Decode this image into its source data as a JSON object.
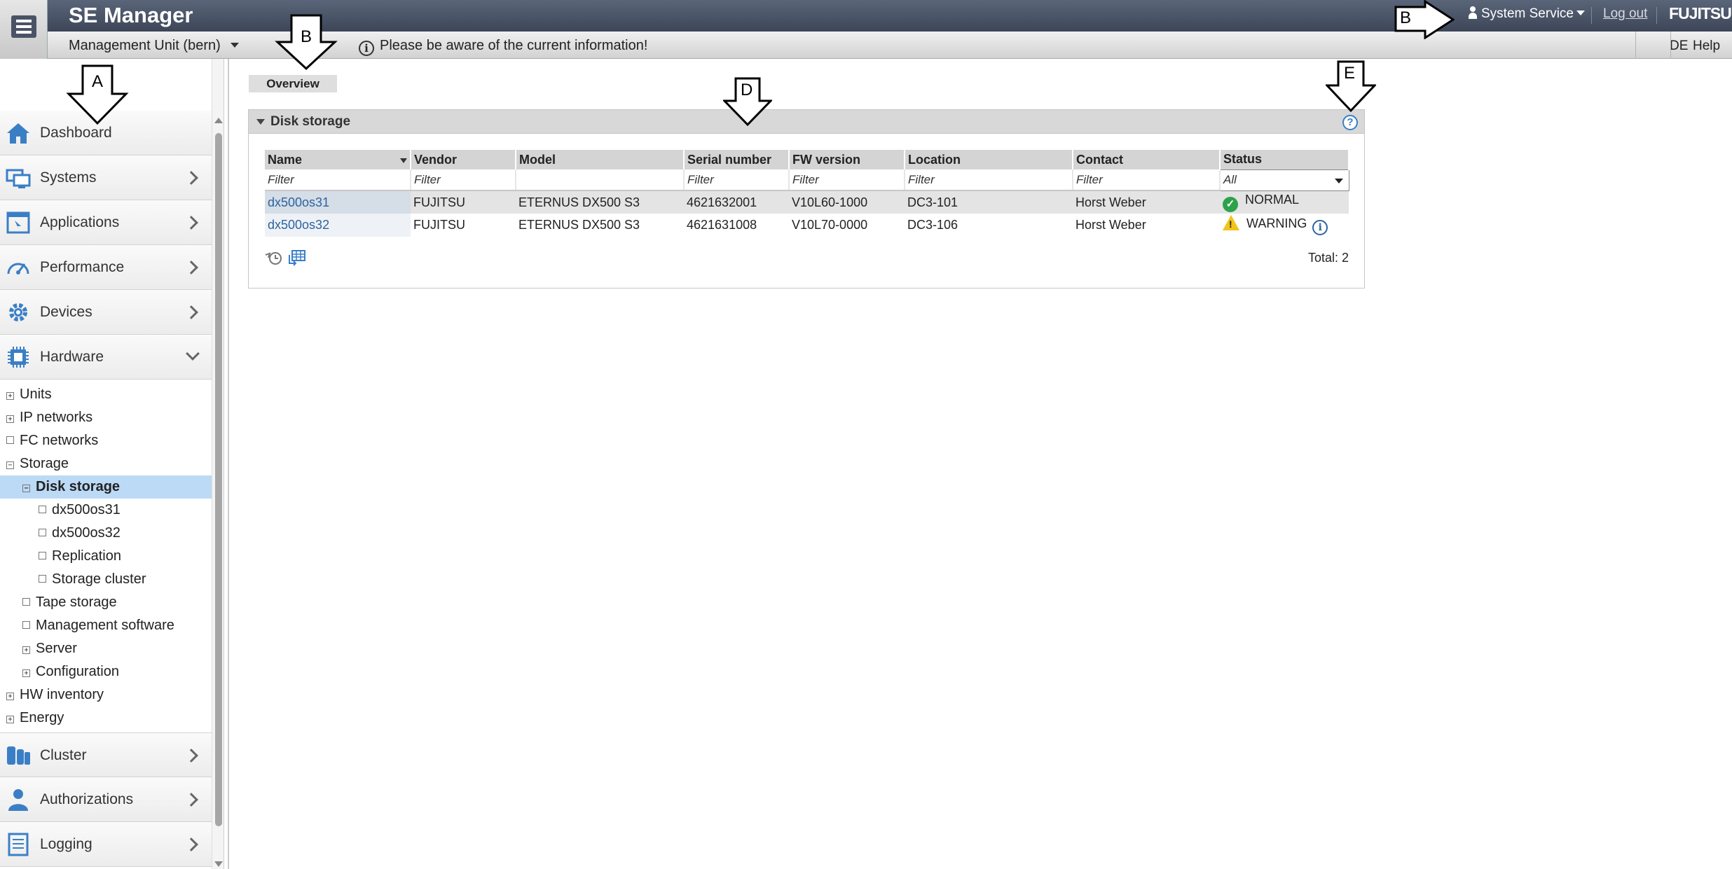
{
  "app": {
    "title": "SE Manager",
    "brand": "FUJITSU",
    "user_menu": "System Service",
    "logout": "Log out",
    "unit_select": "Management Unit (bern)",
    "info_message": "Please be aware of the current information!",
    "lang": "DE",
    "help": "Help"
  },
  "sidebar": {
    "menu": [
      {
        "label": "Dashboard",
        "icon": "home-icon"
      },
      {
        "label": "Systems",
        "icon": "systems-icon"
      },
      {
        "label": "Applications",
        "icon": "applications-icon"
      },
      {
        "label": "Performance",
        "icon": "gauge-icon"
      },
      {
        "label": "Devices",
        "icon": "gear-icon"
      },
      {
        "label": "Hardware",
        "icon": "chip-icon"
      }
    ],
    "tree": [
      {
        "label": "Units",
        "box": "+"
      },
      {
        "label": "IP networks",
        "box": "+"
      },
      {
        "label": "FC networks",
        "box": ""
      },
      {
        "label": "Storage",
        "box": "−"
      },
      {
        "label": "Disk storage",
        "box": "−"
      },
      {
        "label": "dx500os31",
        "box": ""
      },
      {
        "label": "dx500os32",
        "box": ""
      },
      {
        "label": "Replication",
        "box": ""
      },
      {
        "label": "Storage cluster",
        "box": ""
      },
      {
        "label": "Tape storage",
        "box": ""
      },
      {
        "label": "Management software",
        "box": ""
      },
      {
        "label": "Server",
        "box": "+"
      },
      {
        "label": "Configuration",
        "box": "+"
      },
      {
        "label": "HW inventory",
        "box": "+"
      },
      {
        "label": "Energy",
        "box": "+"
      }
    ],
    "menu_bottom": [
      {
        "label": "Cluster",
        "icon": "cluster-icon"
      },
      {
        "label": "Authorizations",
        "icon": "user-icon"
      },
      {
        "label": "Logging",
        "icon": "log-icon"
      }
    ]
  },
  "content": {
    "tab": "Overview",
    "panel_title": "Disk storage",
    "columns": [
      "Name",
      "Vendor",
      "Model",
      "Serial number",
      "FW version",
      "Location",
      "Contact",
      "Status"
    ],
    "filter_placeholder": "Filter",
    "status_filter": "All",
    "rows": [
      {
        "name": "dx500os31",
        "vendor": "FUJITSU",
        "model": "ETERNUS DX500 S3",
        "serial": "4621632001",
        "fw": "V10L60-1000",
        "location": "DC3-101",
        "contact": "Horst Weber",
        "status": "NORMAL"
      },
      {
        "name": "dx500os32",
        "vendor": "FUJITSU",
        "model": "ETERNUS DX500 S3",
        "serial": "4621631008",
        "fw": "V10L70-0000",
        "location": "DC3-106",
        "contact": "Horst Weber",
        "status": "WARNING"
      }
    ],
    "total": "Total: 2"
  },
  "annotations": {
    "a": "A",
    "b1": "B",
    "b2": "B",
    "d": "D",
    "e": "E"
  },
  "colors": {
    "topbar": "#4a5366",
    "selected": "#bcdaf6",
    "link": "#2d63a0",
    "ok": "#2ca24a",
    "warn": "#f0c419"
  }
}
